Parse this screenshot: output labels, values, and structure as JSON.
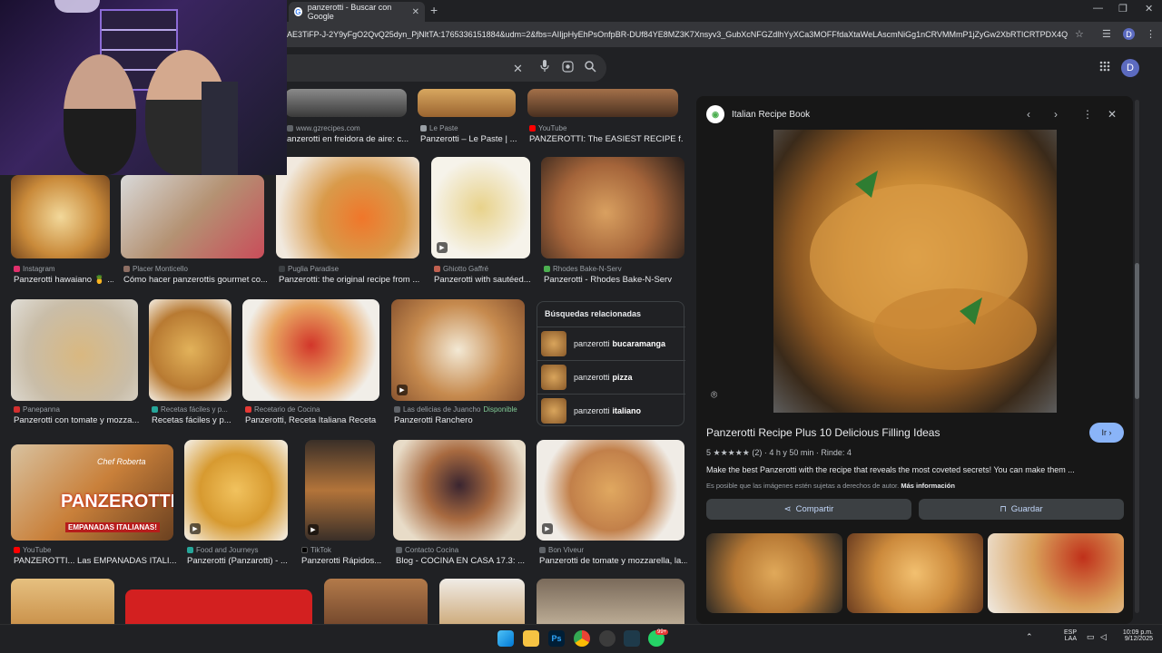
{
  "browser": {
    "tab_title": "panzerotti - Buscar con Google",
    "url": "AE3TiFP-J-2Y9yFgO2QvQ25dyn_PjNltTA:1765336151884&udm=2&fbs=AIIjpHyEhPsOnfpBR-DUf84YE8MZ3K7Xnsyv3_GubXcNFGZdlhYyXCa3MOFFfdaXtaWeLAscmNiGg1nCRVMMmP1jZyGw2XbRTICRTPDX4QDbO8mCalil29j...",
    "profile_initial": "D"
  },
  "search": {
    "clear_icon": "close-icon",
    "mic_icon": "mic-icon",
    "lens_icon": "lens-icon",
    "search_icon": "search-icon"
  },
  "results": [
    {
      "source": "www.gzrecipes.com",
      "title": "anzerotti en freidora de aire: c...",
      "fav": "#5f6368"
    },
    {
      "source": "Le Paste",
      "title": "Panzerotti – Le Paste | ...",
      "fav": "#9aa0a6"
    },
    {
      "source": "YouTube",
      "title": "PANZEROTTI: The EASIEST RECIPE f...",
      "fav": "#ff0000"
    },
    {
      "source": "Instagram",
      "title": "Panzerotti hawaiano 🍍 ...",
      "fav": "#e1306c"
    },
    {
      "source": "Placer Monticello",
      "title": "Cómo hacer panzerottis gourmet co...",
      "fav": "#8d6e63"
    },
    {
      "source": "Puglia Paradise",
      "title": "Panzerotti: the original recipe from ...",
      "fav": "#3c4043"
    },
    {
      "source": "Ghiotto Gaffré",
      "title": "Panzerotti with sautéed...",
      "fav": "#c06050"
    },
    {
      "source": "Rhodes Bake-N-Serv",
      "title": "Panzerotti - Rhodes Bake-N-Serv",
      "fav": "#4caf50"
    },
    {
      "source": "Panepanna",
      "title": "Panzerotti con tomate y mozza...",
      "fav": "#d32f2f"
    },
    {
      "source": "Recetas fáciles y p...",
      "title": "Recetas fáciles y p...",
      "fav": "#26a69a"
    },
    {
      "source": "Recetario de Cocina",
      "title": "Panzerotti, Receta Italiana Receta",
      "fav": "#e53935"
    },
    {
      "source": "Las delicias de Juancho",
      "available": "Disponible",
      "title": "Panzerotti Ranchero",
      "fav": "#5f6368"
    },
    {
      "source": "YouTube",
      "title": "PANZEROTTI... Las EMPANADAS ITALI...",
      "fav": "#ff0000"
    },
    {
      "source": "Food and Journeys",
      "title": "Panzerotti (Panzarotti) - ...",
      "fav": "#26a69a"
    },
    {
      "source": "TikTok",
      "title": "Panzerotti Rápidos...",
      "fav": "#000000"
    },
    {
      "source": "Contacto Cocina",
      "title": "Blog - COCINA EN CASA 17.3: ...",
      "fav": "#5f6368"
    },
    {
      "source": "Bon Viveur",
      "title": "Panzerotti de tomate y mozzarella, la...",
      "fav": "#5f6368"
    }
  ],
  "overlay_text": {
    "chef": "Chef Roberta",
    "big": "PANZEROTTI",
    "sub": "EMPANADAS ITALIANAS!"
  },
  "related": {
    "heading": "Búsquedas relacionadas",
    "items": [
      {
        "prefix": "panzerotti",
        "bold": "bucaramanga"
      },
      {
        "prefix": "panzerotti",
        "bold": "pizza"
      },
      {
        "prefix": "panzerotti",
        "bold": "italiano"
      }
    ]
  },
  "panel": {
    "site": "Italian Recipe Book",
    "title": "Panzerotti Recipe Plus 10 Delicious Filling Ideas",
    "visit": "Ir",
    "rating": "5 ★★★★★ (2) · 4 h y 50 min · Rinde: 4",
    "description": "Make the best Panzerotti with the recipe that reveals the most coveted secrets! You can make them ...",
    "copyright": "Es posible que las imágenes estén sujetas a derechos de autor.",
    "more_info": "Más información",
    "share": "Compartir",
    "save": "Guardar"
  },
  "taskbar": {
    "lang1": "ESP",
    "lang2": "LAA",
    "time": "10:09 p.m.",
    "date": "9/12/2025",
    "badge": "99+"
  }
}
